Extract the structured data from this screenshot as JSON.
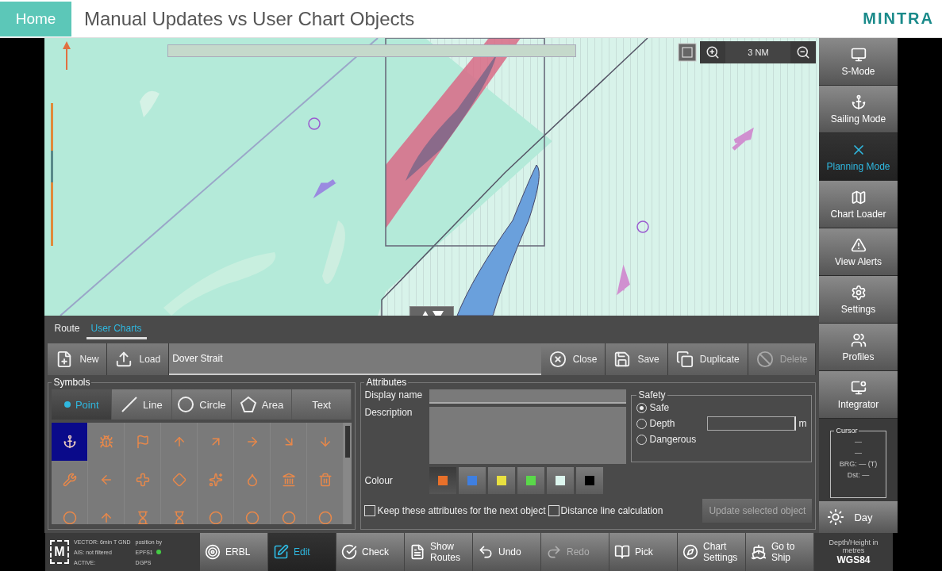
{
  "header": {
    "home": "Home",
    "title": "Manual Updates vs User Chart Objects",
    "logo": "MINTRA"
  },
  "map": {
    "scale": "3 NM"
  },
  "sidebar": {
    "items": [
      {
        "label": "S-Mode",
        "selected": false
      },
      {
        "label": "Sailing Mode",
        "selected": false
      },
      {
        "label": "Planning Mode",
        "selected": true
      },
      {
        "label": "Chart Loader",
        "selected": false
      },
      {
        "label": "View Alerts",
        "selected": false
      },
      {
        "label": "Settings",
        "selected": false
      },
      {
        "label": "Profiles",
        "selected": false
      },
      {
        "label": "Integrator",
        "selected": false
      }
    ]
  },
  "cursor": {
    "title": "Cursor",
    "lines": [
      "—",
      "—",
      "BRG: — (T)",
      "Dst: —"
    ]
  },
  "day": "Day",
  "panel": {
    "tabs": [
      {
        "label": "Route",
        "selected": false
      },
      {
        "label": "User Charts",
        "selected": true
      }
    ],
    "file_actions": [
      {
        "label": "New",
        "disabled": false
      },
      {
        "label": "Load",
        "disabled": false
      }
    ],
    "chart_name": "Dover Strait",
    "chart_actions": [
      {
        "label": "Close",
        "disabled": false
      },
      {
        "label": "Save",
        "disabled": false
      },
      {
        "label": "Duplicate",
        "disabled": false
      },
      {
        "label": "Delete",
        "disabled": true
      }
    ],
    "symbols": {
      "title": "Symbols",
      "tabs": [
        {
          "label": "Point",
          "selected": true
        },
        {
          "label": "Line",
          "selected": false
        },
        {
          "label": "Circle",
          "selected": false
        },
        {
          "label": "Area",
          "selected": false
        },
        {
          "label": "Text",
          "selected": false
        }
      ],
      "items": [
        {
          "selected": true
        },
        {
          "selected": false
        },
        {
          "selected": false
        },
        {
          "selected": false
        },
        {
          "selected": false
        },
        {
          "selected": false
        },
        {
          "selected": false
        },
        {
          "selected": false
        },
        {
          "selected": false
        },
        {
          "selected": false
        },
        {
          "selected": false
        },
        {
          "selected": false
        },
        {
          "selected": false
        },
        {
          "selected": false
        },
        {
          "selected": false
        },
        {
          "selected": false
        },
        {
          "selected": false
        },
        {
          "selected": false
        },
        {
          "selected": false
        },
        {
          "selected": false
        },
        {
          "selected": false
        },
        {
          "selected": false
        },
        {
          "selected": false
        },
        {
          "selected": false
        }
      ]
    },
    "attributes": {
      "title": "Attributes",
      "display_name_label": "Display name",
      "description_label": "Description",
      "colour_label": "Colour",
      "colours": [
        {
          "color": "#e8702a",
          "selected": true
        },
        {
          "color": "#3f7fe0",
          "selected": false
        },
        {
          "color": "#e8e040",
          "selected": false
        },
        {
          "color": "#5ad84a",
          "selected": false
        },
        {
          "color": "#dcf5ee",
          "selected": false
        },
        {
          "color": "#000000",
          "selected": false
        }
      ],
      "safety": {
        "title": "Safety",
        "options": [
          {
            "label": "Safe",
            "selected": true
          },
          {
            "label": "Depth",
            "selected": false
          },
          {
            "label": "Dangerous",
            "selected": false
          }
        ],
        "depth_unit": "m"
      },
      "checkboxes": [
        {
          "label": "Keep these attributes for the next object",
          "checked": false
        },
        {
          "label": "Distance line calculation",
          "checked": false
        }
      ],
      "update_button": {
        "label": "Update selected object",
        "disabled": true
      }
    }
  },
  "status": {
    "logo": "M",
    "vector": [
      "VECTOR: 6min T GND",
      "AIS: not filtered",
      "ACTIVE:"
    ],
    "position": [
      "position by",
      "EPFS1",
      "DGPS"
    ]
  },
  "toolbar": [
    {
      "label": "ERBL",
      "selected": false,
      "disabled": false
    },
    {
      "label": "Edit",
      "selected": true,
      "disabled": false
    },
    {
      "label": "Check",
      "selected": false,
      "disabled": false
    },
    {
      "label": "Show Routes",
      "selected": false,
      "disabled": false
    },
    {
      "label": "Undo",
      "selected": false,
      "disabled": false
    },
    {
      "label": "Redo",
      "selected": false,
      "disabled": true
    },
    {
      "label": "Pick",
      "selected": false,
      "disabled": false
    },
    {
      "label": "Chart Settings",
      "selected": false,
      "disabled": false
    },
    {
      "label": "Go to Ship",
      "selected": false,
      "disabled": false
    }
  ],
  "datum": {
    "caption": "Depth/Height in metres",
    "value": "WGS84"
  }
}
